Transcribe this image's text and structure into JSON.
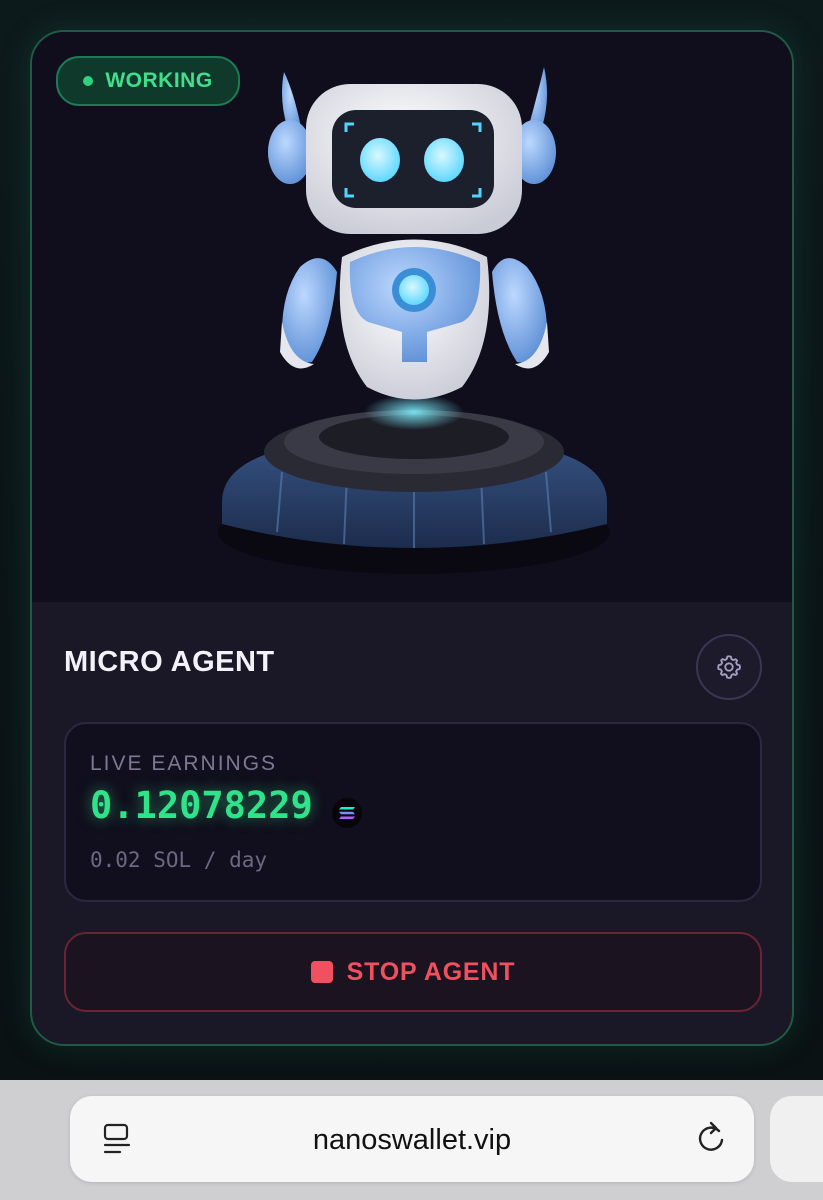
{
  "status": {
    "label": "WORKING"
  },
  "agent": {
    "title": "MICRO AGENT"
  },
  "earnings": {
    "label": "LIVE EARNINGS",
    "value": "0.12078229",
    "rate": "0.02 SOL / day"
  },
  "actions": {
    "stop_label": "STOP AGENT"
  },
  "browser": {
    "url": "nanoswallet.vip"
  },
  "colors": {
    "accent_green": "#2fe38a",
    "stop_red": "#f0505f",
    "card_bg": "#1a1727",
    "robot_blue": "#7fb2f2"
  },
  "icons": {
    "settings": "gear-icon",
    "currency": "solana-icon",
    "stop": "stop-square-icon",
    "reader": "reader-icon",
    "reload": "reload-icon"
  }
}
